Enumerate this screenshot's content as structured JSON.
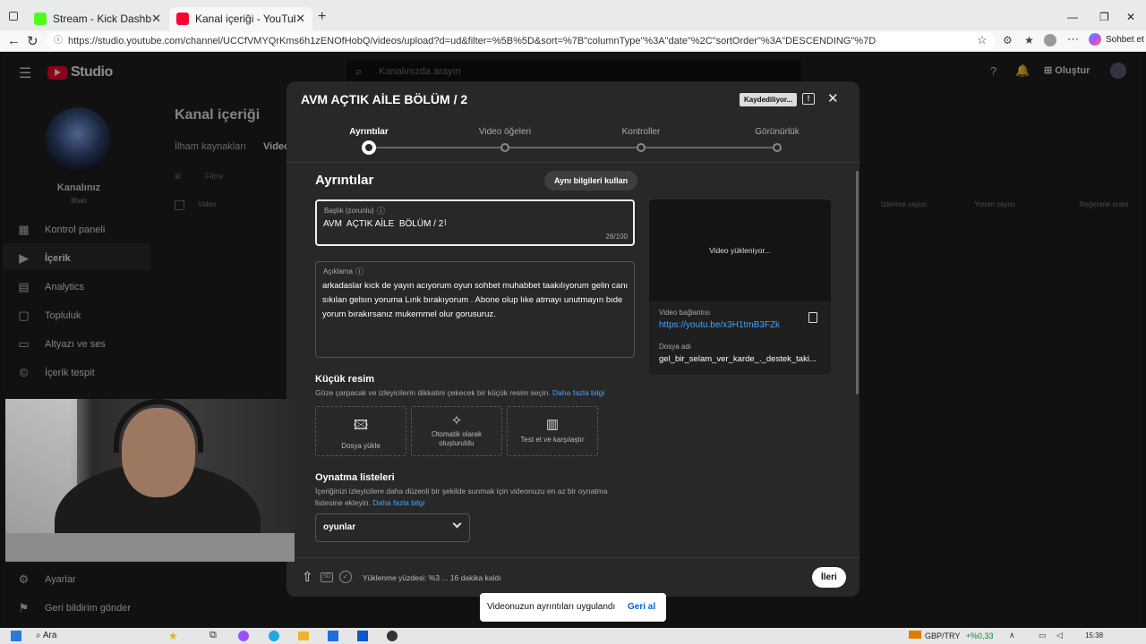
{
  "browser": {
    "tabs": [
      {
        "label": "Stream - Kick Dashboard",
        "favicon_color": "#53fc18"
      },
      {
        "label": "Kanal içeriği - YouTube Studio",
        "favicon_color": "#ff0033"
      }
    ],
    "url": "https://studio.youtube.com/channel/UCCfVMYQrKms6h1zENOfHobQ/videos/upload?d=ud&filter=%5B%5D&sort=%7B\"columnType\"%3A\"date\"%2C\"sortOrder\"%3A\"DESCENDING\"%7D",
    "copilot_label": "Sohbet et"
  },
  "studio": {
    "logo_text": "Studio",
    "search_placeholder": "Kanalınızda arayın",
    "create_label": "Oluştur",
    "channel_name": "Kanalınız",
    "channel_handle": "İlhan",
    "page_title": "Kanal içeriği",
    "tabs": [
      "İlham kaynakları",
      "Video"
    ],
    "filter_placeholder": "Filtre",
    "table_headers": [
      "Video",
      "İzlenme sayısı",
      "Yorum sayısı",
      "Beğenme oranı"
    ],
    "sidebar": [
      {
        "label": "Kontrol paneli",
        "icon": "dashboard-icon"
      },
      {
        "label": "İçerik",
        "icon": "content-icon"
      },
      {
        "label": "Analytics",
        "icon": "analytics-icon"
      },
      {
        "label": "Topluluk",
        "icon": "community-icon"
      },
      {
        "label": "Altyazı ve ses",
        "icon": "subtitles-icon"
      },
      {
        "label": "İçerik tespit",
        "icon": "copyright-icon"
      }
    ],
    "sidebar_bottom": [
      {
        "label": "Ayarlar",
        "icon": "settings-icon"
      },
      {
        "label": "Geri bildirim gönder",
        "icon": "feedback-icon"
      }
    ]
  },
  "modal": {
    "title": "AVM AÇTIK AİLE BÖLÜM / 2",
    "saving_badge": "Kaydediliyor...",
    "steps": [
      "Ayrıntılar",
      "Video öğeleri",
      "Kontroller",
      "Görünürlük"
    ],
    "section_title": "Ayrıntılar",
    "reuse_button": "Aynı bilgileri kullan",
    "title_field": {
      "label": "Başlık (zorunlu)",
      "value": "AVM  AÇTIK AİLE  BÖLÜM / 2",
      "counter": "26/100"
    },
    "description_field": {
      "label": "Açıklama",
      "value": "arkadaslar kıck de yayın acıyorum oyun sohbet muhabbet taakılıyorum gelin canı sıkılan gelsın yoruma Lınk bırakıyorum . Abone olup lıke atmayı unutmayın bıde yorum bırakırsanız mukemmel olur gorusuruz."
    },
    "video_preview": {
      "loading_text": "Video yükleniyor...",
      "link_label": "Video bağlantısı",
      "link": "https://youtu.be/x3H1tmB3FZk",
      "filename_label": "Dosya adı",
      "filename": "gel_bir_selam_ver_karde_._destek_taki..."
    },
    "thumbnail": {
      "title": "Küçük resim",
      "description": "Göze çarpacak ve izleyicilerin dikkatini çekecek bir küçük resim seçin.",
      "link": "Daha fazla bilgi",
      "options": [
        {
          "label": "Dosya yükle",
          "icon": "image-upload-icon"
        },
        {
          "label": "Otomatik olarak oluşturuldu",
          "icon": "sparkle-icon"
        },
        {
          "label": "Test et ve karşılaştır",
          "icon": "chart-icon"
        }
      ]
    },
    "playlists": {
      "title": "Oynatma listeleri",
      "description": "İçeriğinizi izleyicilere daha düzenli bir şekilde sunmak için videonuzu en az bir oynatma listesine ekleyin.",
      "link": "Daha fazla bilgi",
      "selected": "oyunlar"
    },
    "footer": {
      "sd_badge": "SD",
      "status": "Yüklenme yüzdesi: %3 ... 16 dakika kaldı",
      "next_button": "İleri"
    }
  },
  "toast": {
    "message": "Videonuzun ayrıntıları uygulandı",
    "action": "Geri al"
  },
  "taskbar": {
    "search_label": "Ara",
    "ticker_symbol": "GBP/TRY",
    "ticker_change": "+%0,33",
    "time": "15:38"
  }
}
